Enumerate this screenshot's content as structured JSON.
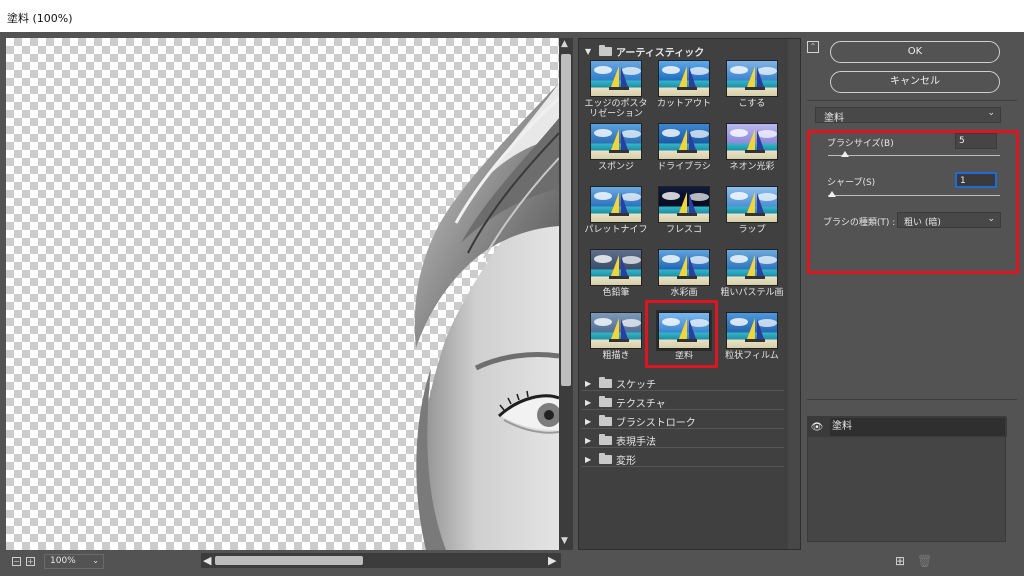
{
  "window": {
    "title": "塗料 (100%)"
  },
  "preview": {
    "zoom": "100%"
  },
  "gallery": {
    "open_category": "アーティスティック",
    "filters": [
      {
        "label": "エッジのポスタリゼーション",
        "icon": "thumb-poster"
      },
      {
        "label": "カットアウト",
        "icon": "thumb-cutout"
      },
      {
        "label": "こする",
        "icon": "thumb-smudge"
      },
      {
        "label": "スポンジ",
        "icon": "thumb-sponge"
      },
      {
        "label": "ドライブラシ",
        "icon": "thumb-drybrush"
      },
      {
        "label": "ネオン光彩",
        "icon": "thumb-neon"
      },
      {
        "label": "パレットナイフ",
        "icon": "thumb-palette"
      },
      {
        "label": "フレスコ",
        "icon": "thumb-fresco"
      },
      {
        "label": "ラップ",
        "icon": "thumb-wrap"
      },
      {
        "label": "色鉛筆",
        "icon": "thumb-pencil"
      },
      {
        "label": "水彩画",
        "icon": "thumb-watercolor"
      },
      {
        "label": "粗いパステル画",
        "icon": "thumb-pastel"
      },
      {
        "label": "粗描き",
        "icon": "thumb-rough"
      },
      {
        "label": "塗料",
        "icon": "thumb-paint"
      },
      {
        "label": "粒状フィルム",
        "icon": "thumb-grain"
      }
    ],
    "selected_filter": "塗料",
    "categories": [
      "スケッチ",
      "テクスチャ",
      "ブラシストローク",
      "表現手法",
      "変形"
    ]
  },
  "buttons": {
    "ok": "OK",
    "cancel": "キャンセル"
  },
  "settings": {
    "filter": "塗料",
    "brush_size_label": "ブラシサイズ(B)",
    "brush_size": "5",
    "brush_size_fraction": 0.1,
    "sharpness_label": "シャープ(S)",
    "sharpness": "1",
    "sharpness_fraction": 0.025,
    "brush_type_label": "ブラシの種類(T) :",
    "brush_type": "粗い (暗)"
  },
  "layers": [
    {
      "name": "塗料",
      "visible": true
    }
  ],
  "colors": {
    "highlight": "#e0141e",
    "focus": "#1e6bd6",
    "panel": "#535353"
  }
}
